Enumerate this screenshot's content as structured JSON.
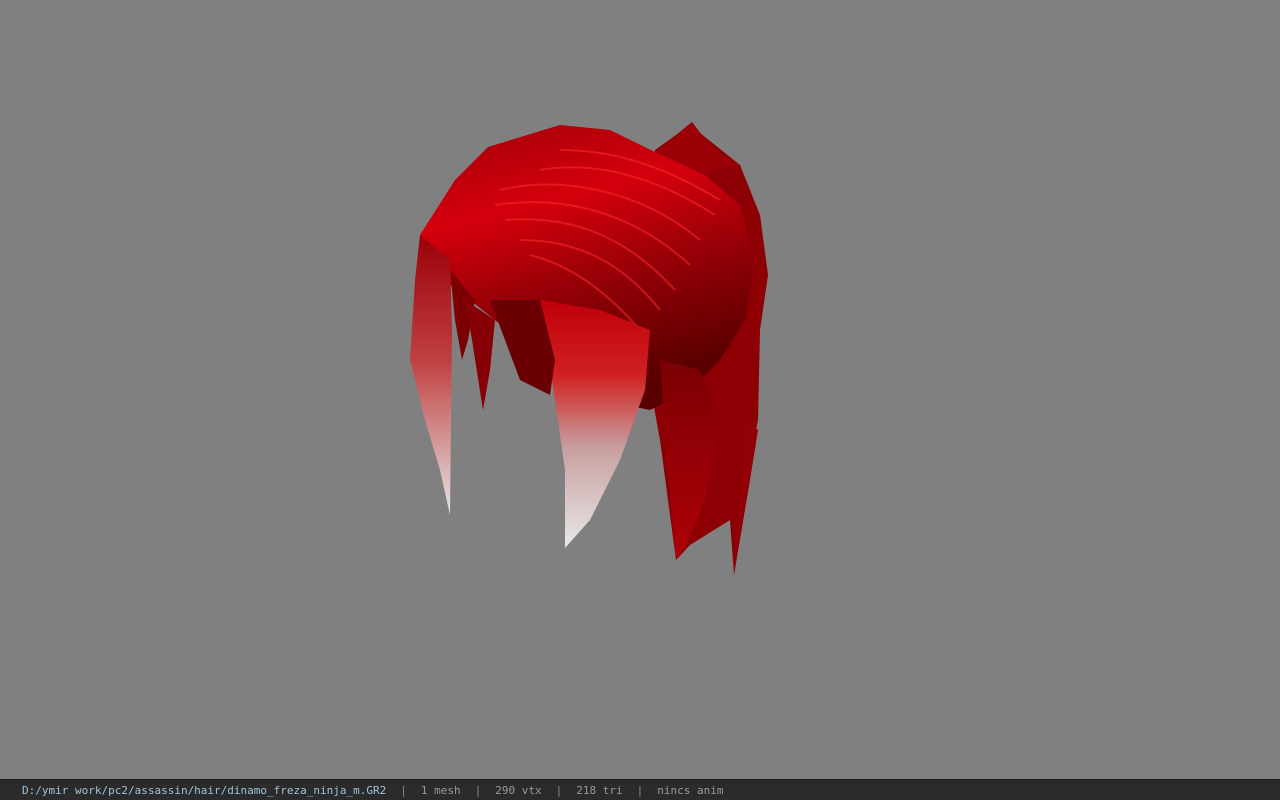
{
  "viewer": {
    "model_name": "dinamo_freza_ninja_m.GR2",
    "model_icon": "hair-mesh-icon"
  },
  "status_bar": {
    "file_path": "D:/ymir work/pc2/assassin/hair/dinamo_freza_ninja_m.GR2",
    "separator": "|",
    "mesh_count": "1 mesh",
    "vertex_count": "290 vtx",
    "triangle_count": "218 tri",
    "animation_status": "nincs anim"
  },
  "colors": {
    "background": "#808080",
    "hair_primary": "#c0000a",
    "hair_dark": "#5a0000",
    "hair_tip": "#e8e8e8",
    "status_bg": "#2b2b2b",
    "path_text": "#9ec4d8"
  }
}
